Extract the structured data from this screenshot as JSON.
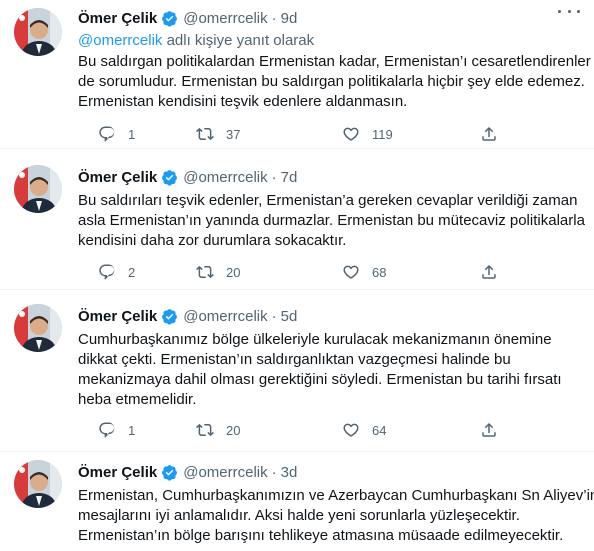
{
  "tweets": [
    {
      "name": "Ömer Çelik",
      "handle": "@omerrcelik",
      "dot": "·",
      "time": "9d",
      "reply_handle": "@omerrcelik",
      "reply_suffix": " adlı kişiye yanıt olarak",
      "lines": [
        "Bu saldırgan politikalardan Ermenistan kadar, Ermenistan’ı cesaretlendirenler",
        "de sorumludur. Ermenistan bu saldırgan politikalarla hiçbir şey elde edemez.",
        "Ermenistan kendisini teşvik edenlere aldanmasın."
      ],
      "replies": "1",
      "retweets": "37",
      "likes": "119"
    },
    {
      "name": "Ömer Çelik",
      "handle": "@omerrcelik",
      "dot": "·",
      "time": "7d",
      "lines": [
        "Bu saldırıları teşvik edenler, Ermenistan’a gereken cevaplar verildiği zaman",
        "asla Ermenistan’ın yanında durmazlar. Ermenistan bu mütecaviz politikalarla",
        "kendisini daha zor durumlara sokacaktır."
      ],
      "replies": "2",
      "retweets": "20",
      "likes": "68"
    },
    {
      "name": "Ömer Çelik",
      "handle": "@omerrcelik",
      "dot": "·",
      "time": "5d",
      "lines": [
        "Cumhurbaşkanımız  bölge ülkeleriyle kurulacak mekanizmanın önemine",
        "dikkat çekti. Ermenistan’ın saldırganlıktan vazgeçmesi halinde bu",
        "mekanizmaya dahil olması gerektiğini söyledi. Ermenistan bu tarihi fırsatı",
        "heba etmemelidir."
      ],
      "replies": "1",
      "retweets": "20",
      "likes": "64"
    },
    {
      "name": "Ömer Çelik",
      "handle": "@omerrcelik",
      "dot": "·",
      "time": "3d",
      "lines": [
        "Ermenistan, Cumhurbaşkanımızın ve Azerbaycan Cumhurbaşkanı Sn Aliyev’in",
        "mesajlarını iyi anlamalıdır. Aksi halde yeni sorunlarla yüzleşecektir.",
        "Ermenistan’ın bölge barışını tehlikeye atmasına müsaade edilmeyecektir."
      ]
    }
  ],
  "colors": {
    "text": "#0f1419",
    "secondary": "#536471",
    "link": "#1d9bf0",
    "verified": "#1d9bf0",
    "divider": "#eff3f4"
  },
  "icons": [
    "verified-badge-icon",
    "more-icon",
    "reply-icon",
    "retweet-icon",
    "like-icon",
    "share-icon"
  ]
}
